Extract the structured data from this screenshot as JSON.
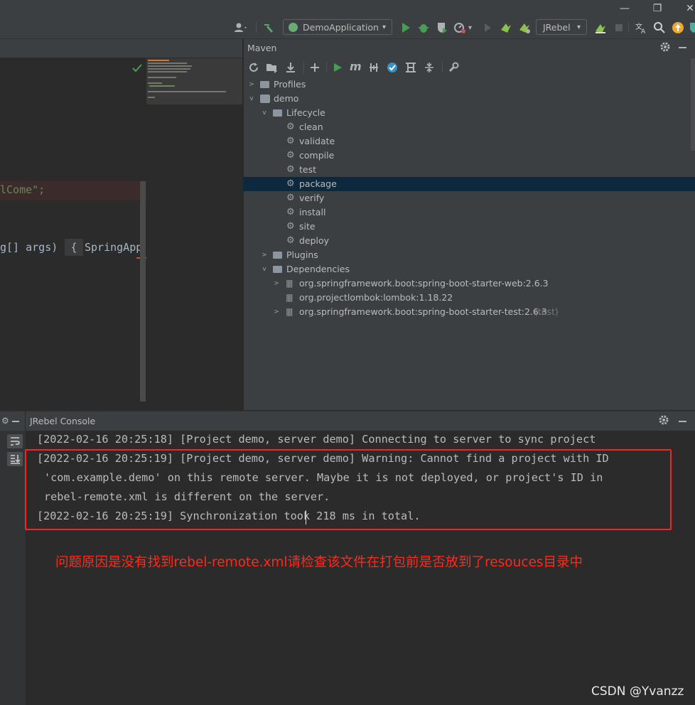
{
  "window": {
    "minimize": "—",
    "restore": "❐",
    "close": "✕"
  },
  "toolbar": {
    "run_config": "DemoApplication",
    "jrebel_combo": "JRebel",
    "dropdown_arrow": "▾"
  },
  "editor": {
    "line1": "lCome\";",
    "line2": "g[] args)",
    "line2b": "{",
    "line2c": "SpringApp"
  },
  "maven": {
    "title": "Maven",
    "tree": {
      "profiles": "Profiles",
      "demo": "demo",
      "lifecycle": "Lifecycle",
      "phases": [
        "clean",
        "validate",
        "compile",
        "test",
        "package",
        "verify",
        "install",
        "site",
        "deploy"
      ],
      "plugins": "Plugins",
      "dependencies": "Dependencies",
      "deps": [
        {
          "name": "org.springframework.boot:spring-boot-starter-web:2.6.3",
          "scope": ""
        },
        {
          "name": "org.projectlombok:lombok:1.18.22",
          "scope": ""
        },
        {
          "name": "org.springframework.boot:spring-boot-starter-test:2.6.3",
          "scope": "(test)"
        }
      ]
    }
  },
  "console": {
    "title": "JRebel Console",
    "lines": [
      "[2022-02-16 20:25:18] [Project demo, server demo] Connecting to server to sync project",
      "[2022-02-16 20:25:19] [Project demo, server demo] Warning: Cannot find a project with ID",
      "'com.example.demo' on this remote server. Maybe it is not deployed, or project's ID in",
      "rebel-remote.xml is different on the server.",
      "[2022-02-16 20:25:19] Synchronization took 218 ms in total."
    ]
  },
  "annotation": "问题原因是没有找到rebel-remote.xml请检查该文件在打包前是否放到了resouces目录中",
  "watermark": "CSDN @Yvanzz",
  "colors": {
    "highlight_box": "#ff2020",
    "annotation": "#ff2a1a",
    "selection": "#0d293e"
  }
}
